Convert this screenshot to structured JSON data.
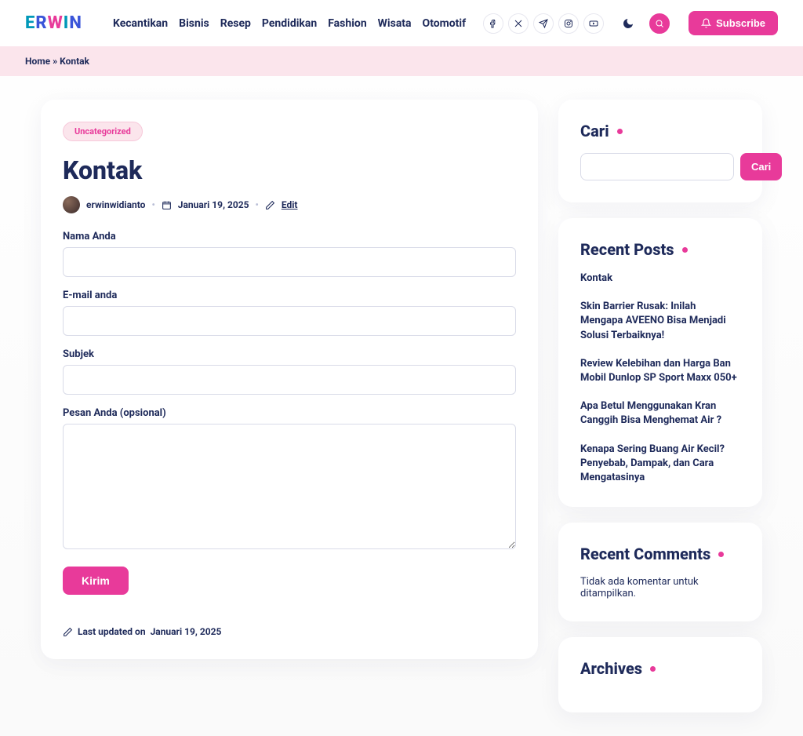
{
  "header": {
    "logo_text": "ERWIN",
    "nav": [
      "Kecantikan",
      "Bisnis",
      "Resep",
      "Pendidikan",
      "Fashion",
      "Wisata",
      "Otomotif"
    ],
    "subscribe_label": "Subscribe"
  },
  "breadcrumb": {
    "home": "Home",
    "sep": "»",
    "current": "Kontak"
  },
  "post": {
    "category": "Uncategorized",
    "title": "Kontak",
    "author": "erwinwidianto",
    "date": "Januari 19, 2025",
    "edit_label": "Edit",
    "last_updated_prefix": "Last updated on",
    "last_updated_date": "Januari 19, 2025"
  },
  "form": {
    "name_label": "Nama Anda",
    "email_label": "E-mail anda",
    "subject_label": "Subjek",
    "message_label": "Pesan Anda (opsional)",
    "submit_label": "Kirim"
  },
  "sidebar": {
    "search": {
      "title": "Cari",
      "button": "Cari"
    },
    "recent_posts": {
      "title": "Recent Posts",
      "items": [
        "Kontak",
        "Skin Barrier Rusak: Inilah Mengapa AVEENO Bisa Menjadi Solusi Terbaiknya!",
        "Review Kelebihan dan Harga Ban Mobil Dunlop SP Sport Maxx 050+",
        "Apa Betul Menggunakan Kran Canggih Bisa Menghemat Air ?",
        "Kenapa Sering Buang Air Kecil? Penyebab, Dampak, dan Cara Mengatasinya"
      ]
    },
    "recent_comments": {
      "title": "Recent Comments",
      "empty": "Tidak ada komentar untuk ditampilkan."
    },
    "archives": {
      "title": "Archives"
    }
  }
}
